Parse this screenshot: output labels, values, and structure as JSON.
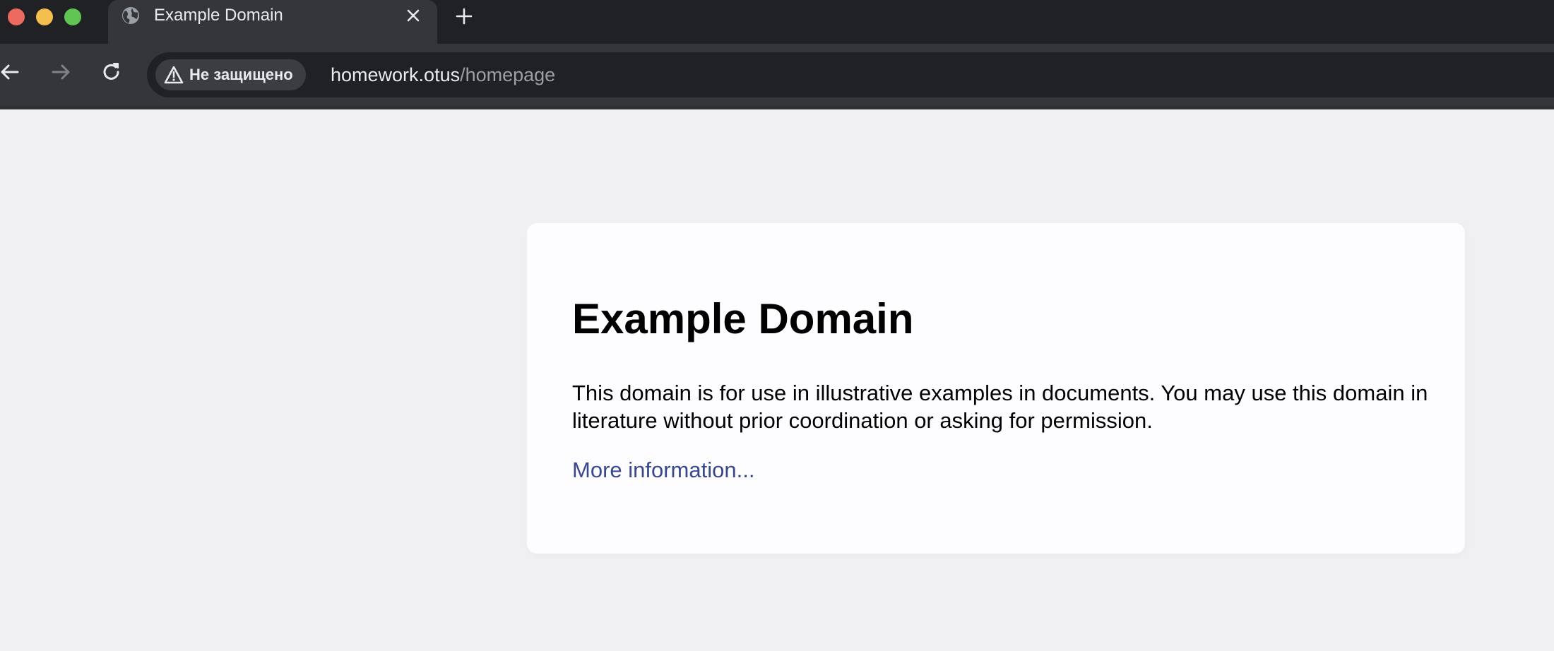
{
  "window": {
    "traffic_lights": [
      "close",
      "minimize",
      "maximize"
    ]
  },
  "tab": {
    "title": "Example Domain",
    "favicon": "globe-icon",
    "close_icon": "close-icon"
  },
  "new_tab_icon": "plus-icon",
  "toolbar": {
    "back_icon": "back-arrow-icon",
    "forward_icon": "forward-arrow-icon",
    "reload_icon": "reload-icon"
  },
  "address_bar": {
    "security_label": "Не защищено",
    "security_icon": "warning-triangle-icon",
    "url_host": "homework.otus",
    "url_path": "/homepage"
  },
  "page": {
    "heading": "Example Domain",
    "description": "This domain is for use in illustrative examples in documents. You may use this domain in literature without prior coordination or asking for permission.",
    "link_text": "More information..."
  },
  "colors": {
    "page_background": "#f0f0f2",
    "card_background": "#fdfdff",
    "link": "#38488f",
    "chrome_dark": "#202124",
    "chrome_toolbar": "#35363a"
  }
}
